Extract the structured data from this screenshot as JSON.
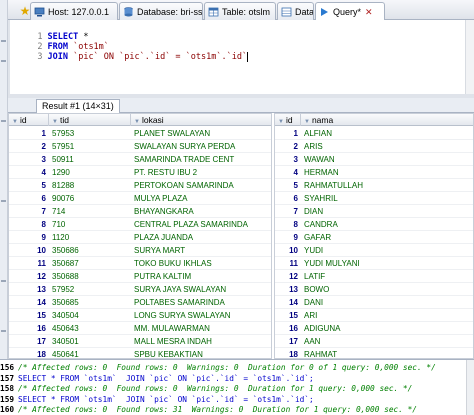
{
  "tabs": [
    {
      "label": "Host: 127.0.0.1",
      "icon": "host-icon"
    },
    {
      "label": "Database: bri-ssi",
      "icon": "database-icon"
    },
    {
      "label": "Table: otslm",
      "icon": "table-icon"
    },
    {
      "label": "Data",
      "icon": "data-icon"
    },
    {
      "label": "Query*",
      "icon": "query-icon",
      "active": true,
      "close": "✕"
    }
  ],
  "editor": {
    "lines": [
      {
        "num": "1",
        "kw": "SELECT",
        "rest": " *"
      },
      {
        "num": "2",
        "kw": "FROM",
        "rest": " `ots1m`"
      },
      {
        "num": "3",
        "kw": "JOIN",
        "rest": " `pic` ON `pic`.`id` = `ots1m`.`id`"
      }
    ]
  },
  "result_tab": {
    "label": "Result #1 (14×31)"
  },
  "grid1": {
    "columns": [
      "id",
      "tid",
      "lokasi"
    ],
    "rows": [
      [
        "1",
        "57953",
        "PLANET SWALAYAN"
      ],
      [
        "2",
        "57951",
        "SWALAYAN SURYA PERDA"
      ],
      [
        "3",
        "50911",
        "SAMARINDA TRADE CENT"
      ],
      [
        "4",
        "1290",
        "PT. RESTU IBU 2"
      ],
      [
        "5",
        "81288",
        "PERTOKOAN SAMARINDA"
      ],
      [
        "6",
        "90076",
        "MULYA PLAZA"
      ],
      [
        "7",
        "714",
        "BHAYANGKARA"
      ],
      [
        "8",
        "710",
        "CENTRAL PLAZA SAMARINDA"
      ],
      [
        "9",
        "1120",
        "PLAZA JUANDA"
      ],
      [
        "10",
        "350686",
        "SURYA MART"
      ],
      [
        "11",
        "350687",
        "TOKO BUKU IKHLAS"
      ],
      [
        "12",
        "350688",
        "PUTRA KALTIM"
      ],
      [
        "13",
        "57952",
        "SURYA JAYA SWALAYAN"
      ],
      [
        "14",
        "350685",
        "POLTABES SAMARINDA"
      ],
      [
        "15",
        "340504",
        "LONG SURYA SWALAYAN"
      ],
      [
        "16",
        "450643",
        "MM. MULAWARMAN"
      ],
      [
        "17",
        "340501",
        "MALL MESRA INDAH"
      ],
      [
        "18",
        "450641",
        "SPBU KEBAKTIAN"
      ]
    ]
  },
  "grid2": {
    "columns": [
      "id",
      "nama"
    ],
    "rows": [
      [
        "1",
        "ALFIAN"
      ],
      [
        "2",
        "ARIS"
      ],
      [
        "3",
        "WAWAN"
      ],
      [
        "4",
        "HERMAN"
      ],
      [
        "5",
        "RAHMATULLAH"
      ],
      [
        "6",
        "SYAHRIL"
      ],
      [
        "7",
        "DIAN"
      ],
      [
        "8",
        "CANDRA"
      ],
      [
        "9",
        "GAFAR"
      ],
      [
        "10",
        "YUDI"
      ],
      [
        "11",
        "YUDI MULYANI"
      ],
      [
        "12",
        "LATIF"
      ],
      [
        "13",
        "BOWO"
      ],
      [
        "14",
        "DANI"
      ],
      [
        "15",
        "ARI"
      ],
      [
        "16",
        "ADIGUNA"
      ],
      [
        "17",
        "AAN"
      ],
      [
        "18",
        "RAHMAT"
      ]
    ]
  },
  "log": [
    {
      "num": "156",
      "text": "/* Affected rows: 0  Found rows: 0  Warnings: 0  Duration for 0 of 1 query: 0,000 sec. */",
      "comment": true
    },
    {
      "num": "157",
      "text": "SELECT * FROM `ots1m`  JOIN `pic` ON `pic`.`id` = `ots1m`.`id`;",
      "comment": false
    },
    {
      "num": "158",
      "text": "/* Affected rows: 0  Found rows: 0  Warnings: 0  Duration for 1 query: 0,000 sec. */",
      "comment": true
    },
    {
      "num": "159",
      "text": "SELECT * FROM `ots1m`  JOIN `pic` ON `pic`.`id` = `ots1m`.`id`;",
      "comment": false
    },
    {
      "num": "160",
      "text": "/* Affected rows: 0  Found rows: 31  Warnings: 0  Duration for 1 query: 0,000 sec. */",
      "comment": true
    }
  ],
  "colors": {
    "keyword": "#0000cc",
    "string": "#8b0000",
    "number": "#000080",
    "text": "#006400",
    "comment": "#008000"
  }
}
